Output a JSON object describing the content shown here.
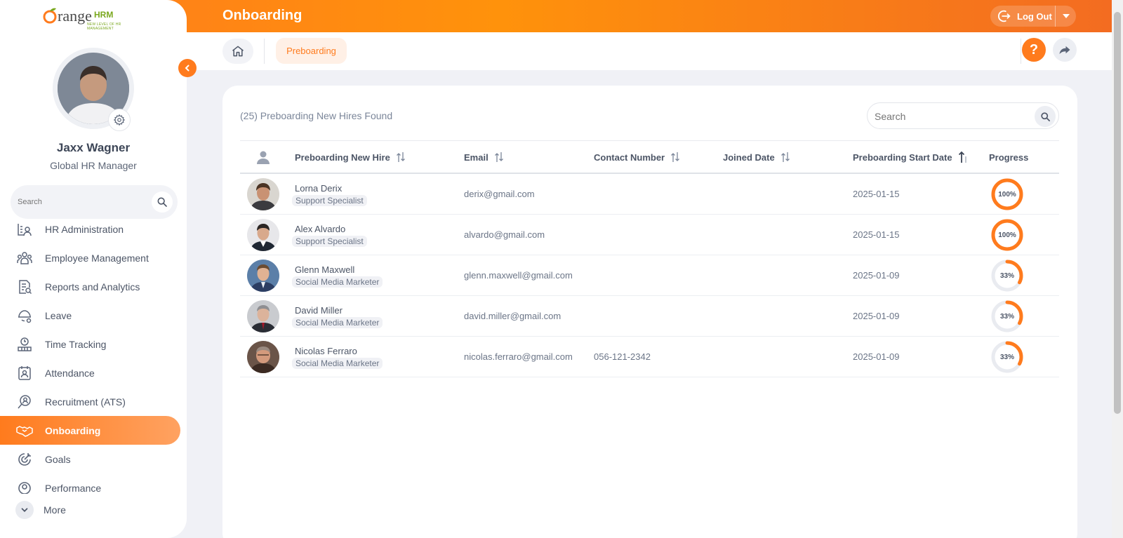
{
  "colors": {
    "accent": "#ff7b1d",
    "accent_dark": "#f36c21",
    "text": "#4c5566",
    "muted": "#7b8699"
  },
  "app": {
    "logo_text": "range",
    "logo_hrm": "HRM",
    "logo_tagline": "NEW LEVEL OF HR MANAGEMENT",
    "page_title": "Onboarding",
    "logout_label": "Log Out"
  },
  "user": {
    "name": "Jaxx Wagner",
    "role": "Global HR Manager"
  },
  "sidebar": {
    "search_placeholder": "Search",
    "items": [
      {
        "label": "HR Administration",
        "icon": "hr-admin-icon"
      },
      {
        "label": "Employee Management",
        "icon": "employees-icon"
      },
      {
        "label": "Reports and Analytics",
        "icon": "reports-icon"
      },
      {
        "label": "Leave",
        "icon": "leave-icon"
      },
      {
        "label": "Time Tracking",
        "icon": "time-tracking-icon"
      },
      {
        "label": "Attendance",
        "icon": "attendance-icon"
      },
      {
        "label": "Recruitment (ATS)",
        "icon": "recruitment-icon"
      },
      {
        "label": "Onboarding",
        "icon": "handshake-icon",
        "active": true
      },
      {
        "label": "Goals",
        "icon": "goals-icon"
      },
      {
        "label": "Performance",
        "icon": "performance-icon"
      }
    ],
    "more_label": "More"
  },
  "subheader": {
    "tab_label": "Preboarding",
    "help_label": "?"
  },
  "list": {
    "found_text": "(25) Preboarding New Hires Found",
    "search_placeholder": "Search",
    "columns": {
      "hire": "Preboarding New Hire",
      "email": "Email",
      "contact": "Contact Number",
      "joined": "Joined Date",
      "start": "Preboarding Start Date",
      "progress": "Progress"
    },
    "rows": [
      {
        "name": "Lorna Derix",
        "job": "Support Specialist",
        "email": "derix@gmail.com",
        "contact": "",
        "joined": "",
        "start": "2025-01-15",
        "progress": 100,
        "progress_label": "100%"
      },
      {
        "name": "Alex Alvardo",
        "job": "Support Specialist",
        "email": "alvardo@gmail.com",
        "contact": "",
        "joined": "",
        "start": "2025-01-15",
        "progress": 100,
        "progress_label": "100%"
      },
      {
        "name": "Glenn Maxwell",
        "job": "Social Media Marketer",
        "email": "glenn.maxwell@gmail.com",
        "contact": "",
        "joined": "",
        "start": "2025-01-09",
        "progress": 33,
        "progress_label": "33%"
      },
      {
        "name": "David Miller",
        "job": "Social Media Marketer",
        "email": "david.miller@gmail.com",
        "contact": "",
        "joined": "",
        "start": "2025-01-09",
        "progress": 33,
        "progress_label": "33%"
      },
      {
        "name": "Nicolas Ferraro",
        "job": "Social Media Marketer",
        "email": "nicolas.ferraro@gmail.com",
        "contact": "056-121-2342",
        "joined": "",
        "start": "2025-01-09",
        "progress": 33,
        "progress_label": "33%"
      }
    ]
  }
}
